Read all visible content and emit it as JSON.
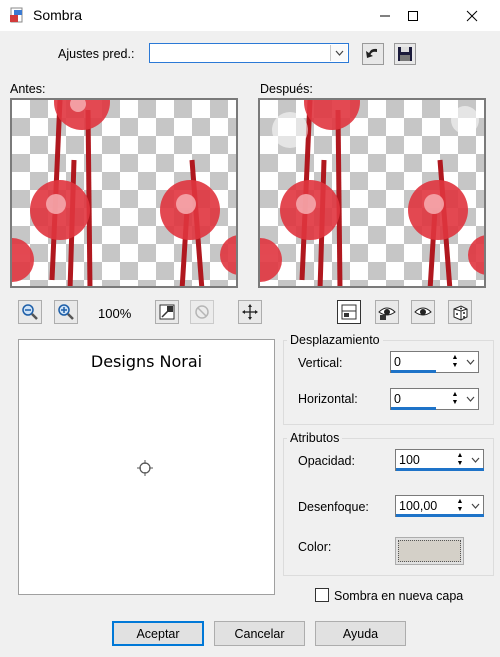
{
  "window": {
    "title": "Sombra",
    "icon": "sombra-dialog-icon"
  },
  "titlebar_buttons": {
    "minimize": "minimize-icon",
    "maximize": "maximize-icon",
    "close": "close-icon"
  },
  "presets": {
    "label": "Ajustes pred.:",
    "value": ""
  },
  "previews": {
    "before_label": "Antes:",
    "after_label": "Después:"
  },
  "zoom": {
    "level": "100%"
  },
  "sample": {
    "text": "Designs Norai"
  },
  "offset": {
    "group_title": "Desplazamiento",
    "vertical_label": "Vertical:",
    "vertical_value": "0",
    "horizontal_label": "Horizontal:",
    "horizontal_value": "0"
  },
  "attributes": {
    "group_title": "Atributos",
    "opacity_label": "Opacidad:",
    "opacity_value": "100",
    "blur_label": "Desenfoque:",
    "blur_value": "100,00",
    "color_label": "Color:",
    "color_value": "#d4d0c8"
  },
  "new_layer": {
    "label": "Sombra en nueva capa",
    "checked": false
  },
  "buttons": {
    "ok": "Aceptar",
    "cancel": "Cancelar",
    "help": "Ayuda"
  },
  "colors": {
    "accent": "#0078d7",
    "flower": "#e0353f",
    "stem": "#b0181f"
  }
}
